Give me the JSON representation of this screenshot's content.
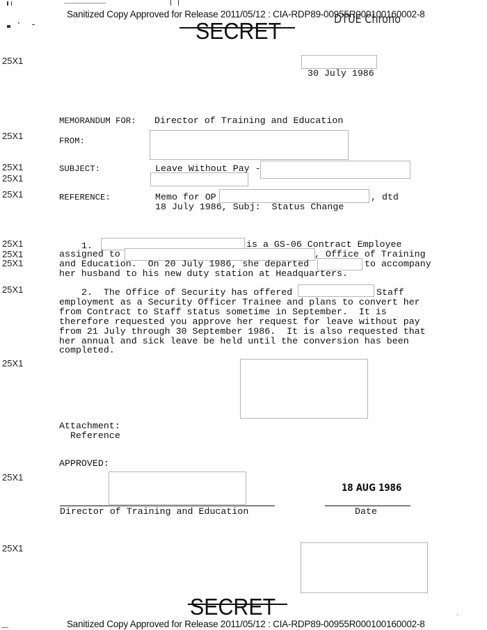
{
  "header": {
    "release_line": "Sanitized Copy Approved for Release 2011/05/12 : CIA-RDP89-00955R000100160002-8",
    "classification": "SECRET",
    "handwritten_note": "DTUE Chrono"
  },
  "footer": {
    "classification": "SECRET",
    "release_line": "Sanitized Copy Approved for Release 2011/05/12 : CIA-RDP89-00955R000100160002-8"
  },
  "margin_marks": {
    "exemption_code": "25X1"
  },
  "memo": {
    "date": "30 July 1986",
    "memorandum_for_label": "MEMORANDUM FOR:",
    "memorandum_for_value": "Director of Training and Education",
    "from_label": "FROM:",
    "subject_label": "SUBJECT:",
    "subject_value": "Leave Without Pay -",
    "reference_label": "REFERENCE:",
    "reference_line1_prefix": "Memo for OP",
    "reference_line1_suffix": ", dtd",
    "reference_line2": "18 July 1986, Subj:  Status Change"
  },
  "paragraph1": {
    "number": "1.",
    "line1_suffix": "is a GS-06 Contract Employee",
    "line2_prefix": "assigned to",
    "line2_suffix": ", Office of Training",
    "line3_prefix": "and Education.  On 20 July 1986, she departed",
    "line3_suffix": "to accompany",
    "line4": "her husband to his new duty station at Headquarters."
  },
  "paragraph2": {
    "line1_prefix": "2.  The Office of Security has offered",
    "line1_suffix": "Staff",
    "lines": [
      "employment as a Security Officer Trainee and plans to convert her",
      "from Contract to Staff status sometime in September.  It is",
      "therefore requested you approve her request for leave without pay",
      "from 21 July through 30 September 1986.  It is also requested that",
      "her annual and sick leave be held until the conversion has been",
      "completed."
    ]
  },
  "attachment": {
    "label": "Attachment:",
    "value": "Reference"
  },
  "approval": {
    "label": "APPROVED:",
    "signature_caption": "Director of Training and Education",
    "date_stamp": "18 AUG 1986",
    "date_caption": "Date"
  }
}
